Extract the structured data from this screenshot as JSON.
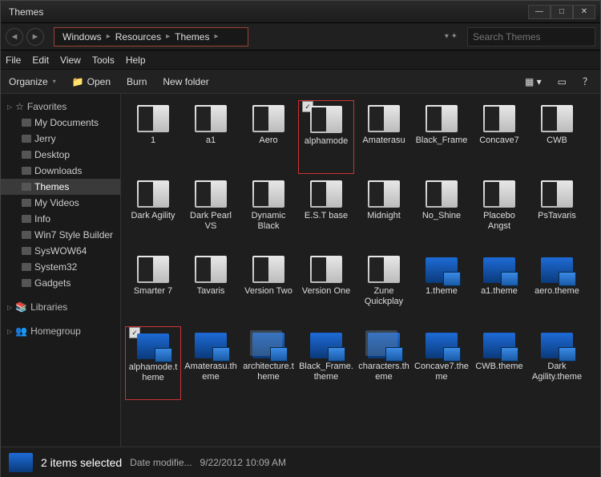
{
  "window": {
    "title": "Themes"
  },
  "breadcrumb": [
    "Windows",
    "Resources",
    "Themes"
  ],
  "search": {
    "placeholder": "Search Themes"
  },
  "menubar": [
    "File",
    "Edit",
    "View",
    "Tools",
    "Help"
  ],
  "toolbar": {
    "organize": "Organize",
    "open": "Open",
    "burn": "Burn",
    "newfolder": "New folder"
  },
  "sidebar": {
    "favorites": {
      "label": "Favorites",
      "items": [
        "My Documents",
        "Jerry",
        "Desktop",
        "Downloads",
        "Themes",
        "My Videos",
        "Info",
        "Win7 Style Builder",
        "SysWOW64",
        "System32",
        "Gadgets"
      ]
    },
    "libraries": {
      "label": "Libraries"
    },
    "homegroup": {
      "label": "Homegroup"
    }
  },
  "files": [
    {
      "name": "1",
      "type": "folder"
    },
    {
      "name": "a1",
      "type": "folder"
    },
    {
      "name": "Aero",
      "type": "folder"
    },
    {
      "name": "alphamode",
      "type": "folder",
      "checked": true,
      "highlight": true
    },
    {
      "name": "Amaterasu",
      "type": "folder"
    },
    {
      "name": "Black_Frame",
      "type": "folder"
    },
    {
      "name": "Concave7",
      "type": "folder"
    },
    {
      "name": "CWB",
      "type": "folder"
    },
    {
      "name": "Dark Agility",
      "type": "folder"
    },
    {
      "name": "Dark Pearl VS",
      "type": "folder"
    },
    {
      "name": "Dynamic Black",
      "type": "folder"
    },
    {
      "name": "E.S.T base",
      "type": "folder"
    },
    {
      "name": "Midnight",
      "type": "folder"
    },
    {
      "name": "No_Shine",
      "type": "folder"
    },
    {
      "name": "Placebo Angst",
      "type": "folder"
    },
    {
      "name": "PsTavaris",
      "type": "folder"
    },
    {
      "name": "Smarter 7",
      "type": "folder"
    },
    {
      "name": "Tavaris",
      "type": "folder"
    },
    {
      "name": "Version Two",
      "type": "folder"
    },
    {
      "name": "Version One",
      "type": "folder"
    },
    {
      "name": "Zune Quickplay",
      "type": "folder",
      "variant": "zune"
    },
    {
      "name": "1.theme",
      "type": "theme"
    },
    {
      "name": "a1.theme",
      "type": "theme"
    },
    {
      "name": "aero.theme",
      "type": "theme"
    },
    {
      "name": "alphamode.theme",
      "type": "theme",
      "checked": true,
      "highlight": true
    },
    {
      "name": "Amaterasu.theme",
      "type": "theme"
    },
    {
      "name": "architecture.theme",
      "type": "theme",
      "multi": true
    },
    {
      "name": "Black_Frame.theme",
      "type": "theme"
    },
    {
      "name": "characters.theme",
      "type": "theme",
      "multi": true
    },
    {
      "name": "Concave7.theme",
      "type": "theme"
    },
    {
      "name": "CWB.theme",
      "type": "theme"
    },
    {
      "name": "Dark Agility.theme",
      "type": "theme"
    }
  ],
  "status": {
    "title": "2 items selected",
    "detail_label": "Date modifie...",
    "detail_value": "9/22/2012 10:09 AM"
  }
}
